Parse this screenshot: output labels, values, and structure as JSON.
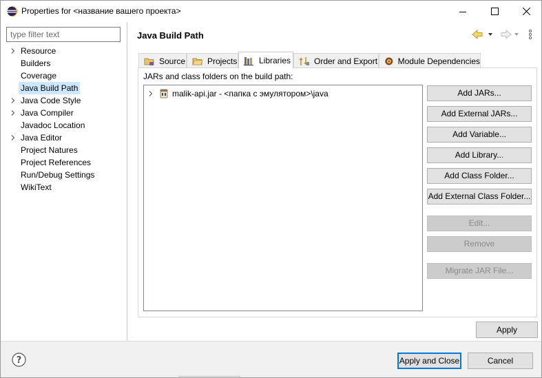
{
  "window": {
    "title": "Properties for <название вашего проекта>"
  },
  "filter": {
    "placeholder": "type filter text"
  },
  "tree": {
    "items": [
      {
        "label": "Resource",
        "expandable": true
      },
      {
        "label": "Builders",
        "expandable": false
      },
      {
        "label": "Coverage",
        "expandable": false
      },
      {
        "label": "Java Build Path",
        "expandable": false,
        "selected": true
      },
      {
        "label": "Java Code Style",
        "expandable": true
      },
      {
        "label": "Java Compiler",
        "expandable": true
      },
      {
        "label": "Javadoc Location",
        "expandable": false
      },
      {
        "label": "Java Editor",
        "expandable": true
      },
      {
        "label": "Project Natures",
        "expandable": false
      },
      {
        "label": "Project References",
        "expandable": false
      },
      {
        "label": "Run/Debug Settings",
        "expandable": false
      },
      {
        "label": "WikiText",
        "expandable": false
      }
    ]
  },
  "page": {
    "title": "Java Build Path"
  },
  "tabs": [
    {
      "label": "Source",
      "icon": "source-folder-icon"
    },
    {
      "label": "Projects",
      "icon": "projects-folder-icon"
    },
    {
      "label": "Libraries",
      "icon": "libraries-icon",
      "active": true
    },
    {
      "label": "Order and Export",
      "icon": "order-export-icon"
    },
    {
      "label": "Module Dependencies",
      "icon": "module-dependencies-icon"
    }
  ],
  "libraries": {
    "label": "JARs and class folders on the build path:",
    "entries": [
      {
        "text": "malik-api.jar - <папка с эмулятором>\\java",
        "icon": "jar-icon"
      }
    ]
  },
  "buttons": {
    "add_jars": "Add JARs...",
    "add_external_jars": "Add External JARs...",
    "add_variable": "Add Variable...",
    "add_library": "Add Library...",
    "add_class_folder": "Add Class Folder...",
    "add_external_class_folder": "Add External Class Folder...",
    "edit": "Edit...",
    "remove": "Remove",
    "migrate_jar": "Migrate JAR File...",
    "apply": "Apply",
    "apply_and_close": "Apply and Close",
    "cancel": "Cancel"
  },
  "colors": {
    "accent": "#0078d7",
    "selection": "#cce8ff",
    "disabled_text": "#8a8a8a"
  }
}
